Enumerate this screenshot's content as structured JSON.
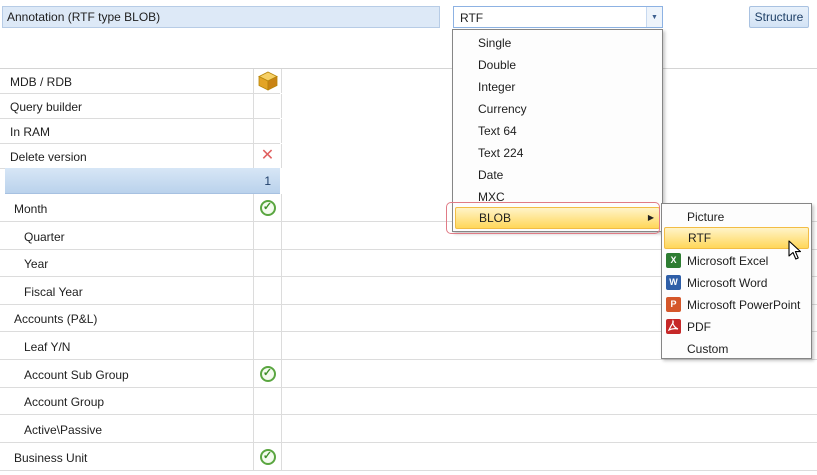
{
  "top": {
    "annotation_label": "Annotation (RTF type BLOB)",
    "type_value": "RTF",
    "structure_label": "Structure"
  },
  "options": [
    {
      "label": "MDB / RDB",
      "icon": "cube-icon"
    },
    {
      "label": "Query builder"
    },
    {
      "label": "In RAM"
    },
    {
      "label": "Delete version",
      "icon": "cross-icon"
    }
  ],
  "header": {
    "column_number": "1"
  },
  "dimensions": [
    {
      "label": "Month",
      "check": true
    },
    {
      "label": "Quarter"
    },
    {
      "label": "Year"
    },
    {
      "label": "Fiscal Year"
    },
    {
      "label": "Accounts (P&L)"
    },
    {
      "label": "Leaf Y/N"
    },
    {
      "label": "Account Sub Group",
      "check": true
    },
    {
      "label": "Account Group"
    },
    {
      "label": "Active\\Passive"
    },
    {
      "label": "Business Unit",
      "check": true
    }
  ],
  "type_menu": {
    "items": [
      "Single",
      "Double",
      "Integer",
      "Currency",
      "Text 64",
      "Text 224",
      "Date",
      "MXC",
      "BLOB"
    ],
    "highlighted": "BLOB"
  },
  "blob_submenu": {
    "items": [
      {
        "label": "Picture"
      },
      {
        "label": "RTF",
        "highlight": true
      },
      {
        "label": "Microsoft Excel",
        "icon": "excel-icon",
        "letter": "X",
        "color": "#2e7d32"
      },
      {
        "label": "Microsoft Word",
        "icon": "word-icon",
        "letter": "W",
        "color": "#2f5fa8"
      },
      {
        "label": "Microsoft PowerPoint",
        "icon": "powerpoint-icon",
        "letter": "P",
        "color": "#d5572a"
      },
      {
        "label": "PDF",
        "icon": "pdf-icon",
        "letter": "",
        "color": "#c62828"
      },
      {
        "label": "Custom"
      }
    ]
  },
  "colors": {
    "accent_blue": "#dde9f7",
    "highlight_gold": "#ffd75a",
    "check_green": "#5aa640"
  }
}
